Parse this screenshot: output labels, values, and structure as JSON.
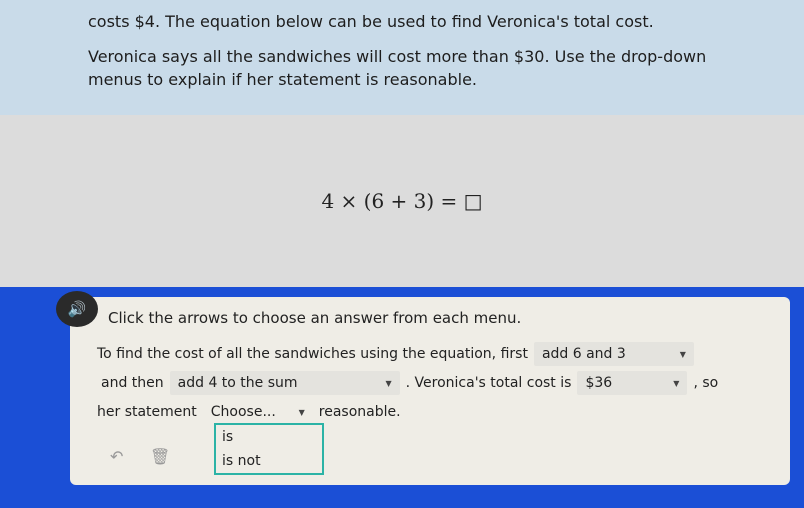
{
  "problem": {
    "line1": "costs $4. The equation below can be used to find Veronica's total cost.",
    "line2": "Veronica says all the sandwiches will cost more than $30. Use the drop-down menus to explain if her statement is reasonable."
  },
  "equation": "4 × (6 + 3) = □",
  "card": {
    "instruction": "Click the arrows to choose an answer from each menu.",
    "s1": "To find the cost of all the sandwiches using the equation, first",
    "dd1": "add 6 and 3",
    "s2": "and then",
    "dd2": "add 4 to the sum",
    "s3": ". Veronica's total cost is",
    "dd3": "$36",
    "s4": ", so",
    "s5": "her statement",
    "dd4": "Choose...",
    "s6": "reasonable.",
    "options": [
      "is",
      "is not"
    ]
  },
  "colors": {
    "background": "#1b4fd6",
    "menu_border": "#2bb3a6"
  }
}
